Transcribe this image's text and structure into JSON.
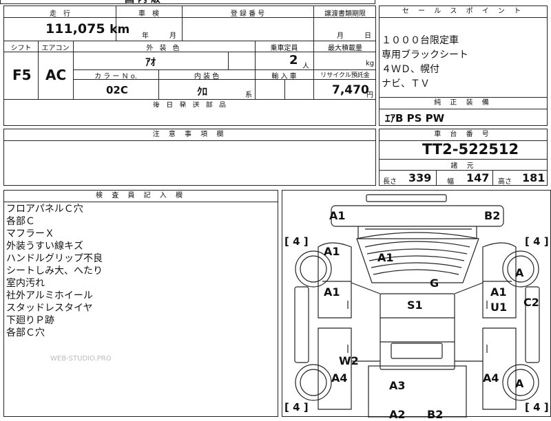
{
  "header": {
    "top_cut_text": "国 内 販"
  },
  "mileage": {
    "label": "走　行",
    "value": "111,075",
    "unit": "km"
  },
  "inspection": {
    "label": "車　検",
    "year_unit": "年",
    "month_unit": "月"
  },
  "registration": {
    "label": "登 録 番 号"
  },
  "transfer": {
    "label": "譲渡書類期限",
    "month_unit": "月",
    "day_unit": "日"
  },
  "shift": {
    "label": "シフト",
    "value": "F5"
  },
  "aircon": {
    "label": "エアコン",
    "value": "AC"
  },
  "exterior_color": {
    "label": "外 装 色",
    "value": "ｱｵ"
  },
  "capacity": {
    "label": "乗車定員",
    "value": "2",
    "unit": "人"
  },
  "max_load": {
    "label": "最大積載量",
    "unit": "kg"
  },
  "color_no": {
    "label": "カ ラ ー Ｎ o.",
    "value": "02C"
  },
  "interior_color": {
    "label": "内 装 色",
    "value": "ｸﾛ",
    "suffix": "系"
  },
  "import": {
    "label": "輸 入 車"
  },
  "recycle": {
    "label": "リサイクル預託金",
    "value": "7,470",
    "unit": "円"
  },
  "later_parts": {
    "label": "後 日 発 送 部 品"
  },
  "sales_point": {
    "label": "セ ー ル ス ポ イ ン ト",
    "lines": [
      "１０００台限定車",
      "専用ブラックシート",
      "４ＷＤ、幌付",
      "ナビ、ＴＶ"
    ]
  },
  "equipment": {
    "label": "純 正 装 備",
    "value": "ｴｱB PS PW"
  },
  "notes": {
    "label": "注 意 事 項 欄"
  },
  "chassis": {
    "label": "車 台 番 号",
    "value": "TT2-522512"
  },
  "specs": {
    "label": "諸 元",
    "length_label": "長さ",
    "length": "339",
    "width_label": "幅",
    "width": "147",
    "height_label": "高さ",
    "height": "181"
  },
  "inspector": {
    "label": "検 査 員 記 入 欄",
    "lines": [
      "フロアパネルＣ穴",
      "各部Ｃ",
      "マフラーＸ",
      "外装うすい線キズ",
      "ハンドルグリップ不良",
      "シートしみ大、へたり",
      "室内汚れ",
      "社外アルミホイール",
      "スタッドレスタイヤ",
      "下廻りＰ跡",
      "各部Ｃ穴"
    ]
  },
  "watermark": "WEB-STUDIO.PRO",
  "diagram": {
    "tire_marks": [
      "[ 4 ]",
      "[ 4 ]",
      "[ 4 ]",
      "[ 4 ]"
    ],
    "marks": {
      "a1_tl": "A1",
      "b2_tr": "B2",
      "a1_left_front": "A1",
      "a1_hood": "A1",
      "a_front_right": "A",
      "g": "G",
      "a1_left": "A1",
      "a1_right": "A1",
      "u1": "U1",
      "s1": "S1",
      "c2": "C2",
      "w2": "W2",
      "a4_left": "A4",
      "a4_right": "A4",
      "a_rear_right": "A",
      "a3": "A3",
      "a2_bottom": "A2",
      "b2_bottom": "B2"
    }
  }
}
